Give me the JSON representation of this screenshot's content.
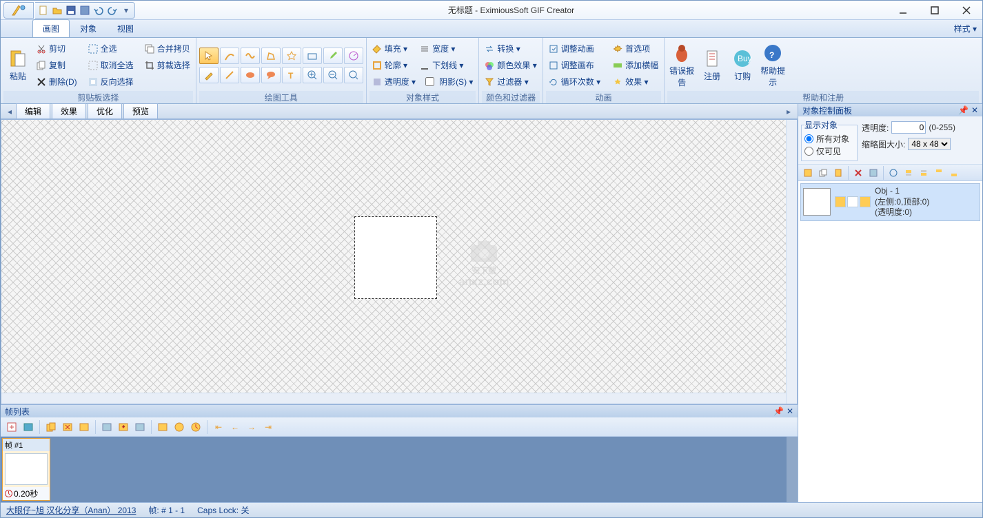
{
  "title": "无标题 - EximiousSoft GIF Creator",
  "mainTabs": {
    "t0": "画图",
    "t1": "对象",
    "t2": "视图",
    "style": "样式 ▾"
  },
  "ribbon": {
    "g1": {
      "paste": "粘贴",
      "cut": "剪切",
      "copy": "复制",
      "del": "删除(D)",
      "foot": "剪贴板选择",
      "selall": "全选",
      "desel": "取消全选",
      "inv": "反向选择",
      "merge": "合并拷贝",
      "cropsel": "剪裁选择"
    },
    "g2": {
      "foot": "绘图工具"
    },
    "g3": {
      "fill": "填充 ▾",
      "outline": "轮廓 ▾",
      "opacity": "透明度 ▾",
      "width": "宽度 ▾",
      "underline": "下划线 ▾",
      "shadow": "阴影(S) ▾",
      "foot": "对象样式"
    },
    "g4": {
      "convert": "转换 ▾",
      "coloreffect": "颜色效果 ▾",
      "filters": "过滤器 ▾",
      "foot": "颜色和过滤器"
    },
    "g5": {
      "adjanim": "调整动画",
      "adjcanvas": "调整画布",
      "loopcount": "循环次数 ▾",
      "preferences": "首选项",
      "addbanner": "添加横幅",
      "effects": "效果 ▾",
      "foot": "动画"
    },
    "g6": {
      "bugreport": "错误报告",
      "register": "注册",
      "order": "订购",
      "help": "帮助提示",
      "foot": "帮助和注册"
    }
  },
  "subTabs": {
    "t0": "编辑",
    "t1": "效果",
    "t2": "优化",
    "t3": "预览"
  },
  "framePanel": {
    "title": "帧列表",
    "frame1": "帧 #1",
    "delay": "0.20秒"
  },
  "right": {
    "title": "对象控制面板",
    "show": "显示对象",
    "all": "所有对象",
    "visible": "仅可见",
    "opacity": "透明度:",
    "opacityRange": "(0-255)",
    "opacityVal": "0",
    "thumbsize": "缩略图大小:",
    "thumbval": "48 x 48",
    "obj": {
      "name": "Obj - 1",
      "pos": "(左侧:0,顶部:0)",
      "op": "(透明度:0)"
    }
  },
  "status": {
    "link": "大眼仔~旭 汉化分享（Anan） 2013",
    "frames": "帧: # 1 - 1",
    "caps": "Caps Lock: 关"
  },
  "watermark": {
    "l1": "安下载",
    "l2": "anxz.com"
  }
}
